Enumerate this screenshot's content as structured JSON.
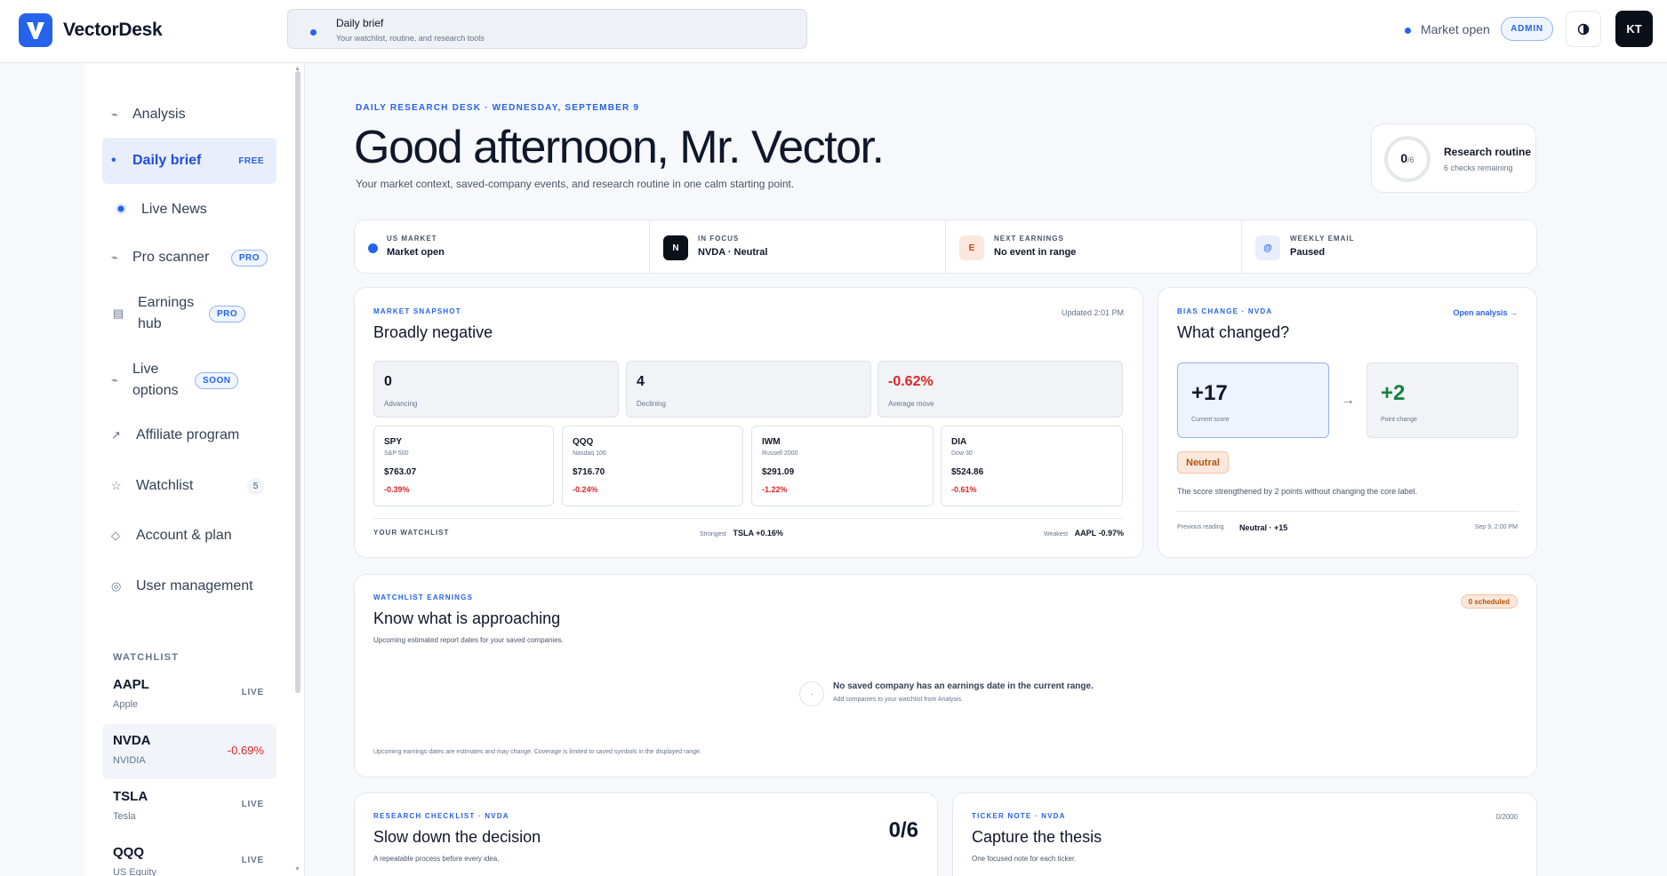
{
  "app": {
    "name": "VectorDesk",
    "logo_letter": "V"
  },
  "context": {
    "title": "Daily brief",
    "subtitle": "Your watchlist, routine, and research tools"
  },
  "header": {
    "market_status": "Market open",
    "role_badge": "ADMIN",
    "avatar_initials": "KT"
  },
  "sidebar": {
    "items": [
      {
        "label": "Analysis",
        "icon": "trend-icon"
      },
      {
        "label": "Daily brief",
        "badge": "FREE",
        "icon": "dot-icon"
      },
      {
        "label": "Live News",
        "icon": "radio-icon"
      },
      {
        "label": "Pro scanner",
        "badge": "PRO",
        "icon": "trend-icon"
      },
      {
        "label": "Earnings hub",
        "badge": "PRO",
        "icon": "list-icon"
      },
      {
        "label": "Live options",
        "badge": "SOON",
        "icon": "trend-icon"
      },
      {
        "label": "Affiliate program",
        "icon": "arrow-icon"
      },
      {
        "label": "Watchlist",
        "count": "5",
        "icon": "star-icon"
      },
      {
        "label": "Account & plan",
        "icon": "diamond-icon"
      },
      {
        "label": "User management",
        "icon": "target-icon"
      }
    ],
    "watchlist_title": "WATCHLIST",
    "watchlist": [
      {
        "symbol": "AAPL",
        "name": "Apple",
        "status": "LIVE"
      },
      {
        "symbol": "NVDA",
        "name": "NVIDIA",
        "status": "-0.69%"
      },
      {
        "symbol": "TSLA",
        "name": "Tesla",
        "status": "LIVE"
      },
      {
        "symbol": "QQQ",
        "name": "US Equity",
        "status": "LIVE"
      }
    ]
  },
  "hero": {
    "eyebrow": "DAILY RESEARCH DESK · WEDNESDAY, SEPTEMBER 9",
    "greeting": "Good afternoon, Mr. Vector.",
    "subtitle": "Your market context, saved-company events, and research routine in one calm starting point.",
    "routine": {
      "done": "0",
      "total": "/6",
      "title": "Research routine",
      "subtitle": "6 checks remaining",
      "progress": 0
    }
  },
  "status_strip": [
    {
      "label": "US MARKET",
      "value": "Market open",
      "icon": "dot"
    },
    {
      "label": "IN FOCUS",
      "value": "NVDA · Neutral",
      "icon": "N"
    },
    {
      "label": "NEXT EARNINGS",
      "value": "No event in range",
      "icon": "E"
    },
    {
      "label": "WEEKLY EMAIL",
      "value": "Paused",
      "icon": "@"
    }
  ],
  "snapshot": {
    "eyebrow": "MARKET SNAPSHOT",
    "title": "Broadly negative",
    "updated": "Updated 2:01 PM",
    "stats": [
      {
        "value": "0",
        "label": "Advancing"
      },
      {
        "value": "4",
        "label": "Declining"
      },
      {
        "value": "-0.62%",
        "label": "Average move"
      }
    ],
    "indices": [
      {
        "symbol": "SPY",
        "name": "S&P 500",
        "price": "$763.07",
        "change": "-0.39%"
      },
      {
        "symbol": "QQQ",
        "name": "Nasdaq 100",
        "price": "$716.70",
        "change": "-0.24%"
      },
      {
        "symbol": "IWM",
        "name": "Russell 2000",
        "price": "$291.09",
        "change": "-1.22%"
      },
      {
        "symbol": "DIA",
        "name": "Dow 30",
        "price": "$524.86",
        "change": "-0.61%"
      }
    ],
    "watchlist_label": "YOUR WATCHLIST",
    "strongest_label": "Strongest",
    "strongest": "TSLA +0.16%",
    "weakest_label": "Weakest",
    "weakest": "AAPL -0.97%"
  },
  "bias": {
    "eyebrow": "BIAS CHANGE · NVDA",
    "link": "Open analysis →",
    "title": "What changed?",
    "current": "+17",
    "current_label": "Current score",
    "arrow": "→",
    "change": "+2",
    "change_label": "Point change",
    "tag": "Neutral",
    "note": "The score strengthened by 2 points without changing the core label.",
    "prev_label": "Previous reading",
    "prev_value": "Neutral · +15",
    "prev_time": "Sep 9, 2:00 PM"
  },
  "earnings": {
    "eyebrow": "WATCHLIST EARNINGS",
    "title": "Know what is approaching",
    "subtitle": "Upcoming estimated report dates for your saved companies.",
    "badge": "0 scheduled",
    "empty_title": "No saved company has an earnings date in the current range.",
    "empty_sub": "Add companies to your watchlist from Analysis.",
    "footnote": "Upcoming earnings dates are estimates and may change. Coverage is limited to saved symbols in the displayed range."
  },
  "checklist": {
    "eyebrow": "RESEARCH CHECKLIST · NVDA",
    "title": "Slow down the decision",
    "subtitle": "A repeatable process before every idea.",
    "score": "0/6"
  },
  "note": {
    "eyebrow": "TICKER NOTE · NVDA",
    "title": "Capture the thesis",
    "subtitle": "One focused note for each ticker.",
    "count": "0/2000"
  }
}
